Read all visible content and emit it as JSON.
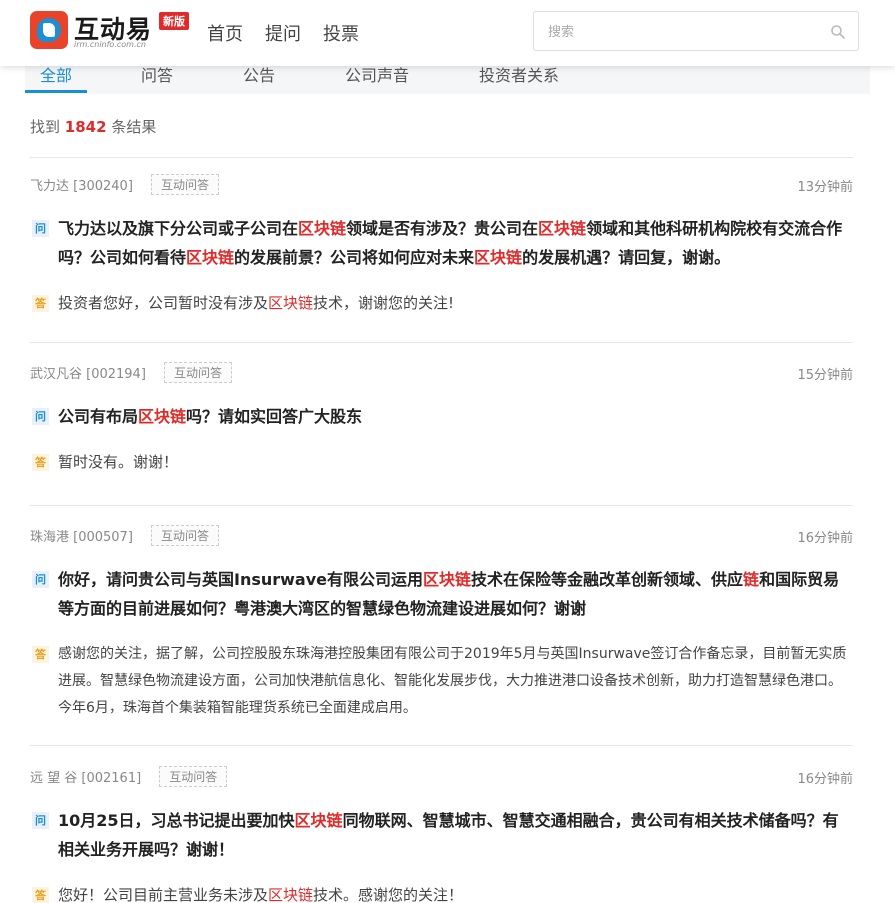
{
  "header": {
    "logo_text": "互动易",
    "logo_sub": "irm.cninfo.com.cn",
    "logo_badge": "新版",
    "nav": [
      "首页",
      "提问",
      "投票"
    ],
    "search_placeholder": "搜索"
  },
  "tabs": [
    "全部",
    "问答",
    "公告",
    "公司声音",
    "投资者关系"
  ],
  "result": {
    "prefix": "找到",
    "count": "1842",
    "suffix": "条结果"
  },
  "items": [
    {
      "company": "飞力达 [300240]",
      "tag": "互动问答",
      "time": "13分钟前",
      "q_icon": "问",
      "a_icon": "答",
      "q_parts": [
        "飞力达以及旗下分公司或子公司在",
        "区块链",
        "领域是否有涉及？贵公司在",
        "区块链",
        "领域和其他科研机构院校有交流合作吗？公司如何看待",
        "区块链",
        "的发展前景？公司将如何应对未来",
        "区块链",
        "的发展机遇？请回复，谢谢。"
      ],
      "a_parts": [
        "投资者您好，公司暂时没有涉及",
        "区块链",
        "技术，谢谢您的关注!"
      ]
    },
    {
      "company": "武汉凡谷 [002194]",
      "tag": "互动问答",
      "time": "15分钟前",
      "q_icon": "问",
      "a_icon": "答",
      "q_parts": [
        "公司有布局",
        "区块链",
        "吗？请如实回答广大股东"
      ],
      "a_parts": [
        "暂时没有。谢谢！"
      ]
    },
    {
      "company": "珠海港 [000507]",
      "tag": "互动问答",
      "time": "16分钟前",
      "q_icon": "问",
      "a_icon": "答",
      "q_parts": [
        "你好，请问贵公司与英国Insurwave有限公司运用",
        "区块链",
        "技术在保险等金融改革创新领域、供应",
        "链",
        "和国际贸易等方面的目前进展如何？粤港澳大湾区的智慧绿色物流建设进展如何？谢谢"
      ],
      "a_parts": [
        "感谢您的关注，据了解，公司控股股东珠海港控股集团有限公司于2019年5月与英国Insurwave签订合作备忘录，目前暂无实质进展。智慧绿色物流建设方面，公司加快港航信息化、智能化发展步伐，大力推进港口设备技术创新，助力打造智慧绿色港口。今年6月，珠海首个集装箱智能理货系统已全面建成启用。"
      ]
    },
    {
      "company": "远 望 谷 [002161]",
      "tag": "互动问答",
      "time": "16分钟前",
      "q_icon": "问",
      "a_icon": "答",
      "q_parts": [
        "10月25日，习总书记提出要加快",
        "区块链",
        "同物联网、智慧城市、智慧交通相融合，贵公司有相关技术储备吗？有相关业务开展吗？谢谢！"
      ],
      "a_parts": [
        "您好！公司目前主营业务未涉及",
        "区块链",
        "技术。感谢您的关注！"
      ]
    }
  ]
}
